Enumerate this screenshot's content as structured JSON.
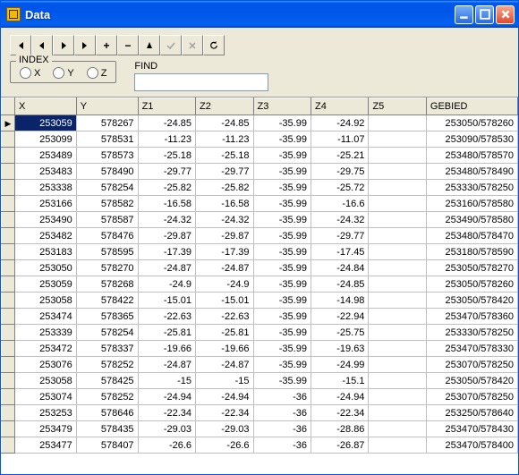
{
  "window": {
    "title": "Data"
  },
  "index_group": {
    "legend": "INDEX",
    "x_label": "X",
    "y_label": "Y",
    "z_label": "Z"
  },
  "find": {
    "label": "FIND",
    "value": ""
  },
  "columns": [
    "X",
    "Y",
    "Z1",
    "Z2",
    "Z3",
    "Z4",
    "Z5",
    "GEBIED"
  ],
  "rows": [
    {
      "X": "253059",
      "Y": "578267",
      "Z1": "-24.85",
      "Z2": "-24.85",
      "Z3": "-35.99",
      "Z4": "-24.92",
      "Z5": "",
      "GEBIED": "253050/578260"
    },
    {
      "X": "253099",
      "Y": "578531",
      "Z1": "-11.23",
      "Z2": "-11.23",
      "Z3": "-35.99",
      "Z4": "-11.07",
      "Z5": "",
      "GEBIED": "253090/578530"
    },
    {
      "X": "253489",
      "Y": "578573",
      "Z1": "-25.18",
      "Z2": "-25.18",
      "Z3": "-35.99",
      "Z4": "-25.21",
      "Z5": "",
      "GEBIED": "253480/578570"
    },
    {
      "X": "253483",
      "Y": "578490",
      "Z1": "-29.77",
      "Z2": "-29.77",
      "Z3": "-35.99",
      "Z4": "-29.75",
      "Z5": "",
      "GEBIED": "253480/578490"
    },
    {
      "X": "253338",
      "Y": "578254",
      "Z1": "-25.82",
      "Z2": "-25.82",
      "Z3": "-35.99",
      "Z4": "-25.72",
      "Z5": "",
      "GEBIED": "253330/578250"
    },
    {
      "X": "253166",
      "Y": "578582",
      "Z1": "-16.58",
      "Z2": "-16.58",
      "Z3": "-35.99",
      "Z4": "-16.6",
      "Z5": "",
      "GEBIED": "253160/578580"
    },
    {
      "X": "253490",
      "Y": "578587",
      "Z1": "-24.32",
      "Z2": "-24.32",
      "Z3": "-35.99",
      "Z4": "-24.32",
      "Z5": "",
      "GEBIED": "253490/578580"
    },
    {
      "X": "253482",
      "Y": "578476",
      "Z1": "-29.87",
      "Z2": "-29.87",
      "Z3": "-35.99",
      "Z4": "-29.77",
      "Z5": "",
      "GEBIED": "253480/578470"
    },
    {
      "X": "253183",
      "Y": "578595",
      "Z1": "-17.39",
      "Z2": "-17.39",
      "Z3": "-35.99",
      "Z4": "-17.45",
      "Z5": "",
      "GEBIED": "253180/578590"
    },
    {
      "X": "253050",
      "Y": "578270",
      "Z1": "-24.87",
      "Z2": "-24.87",
      "Z3": "-35.99",
      "Z4": "-24.84",
      "Z5": "",
      "GEBIED": "253050/578270"
    },
    {
      "X": "253059",
      "Y": "578268",
      "Z1": "-24.9",
      "Z2": "-24.9",
      "Z3": "-35.99",
      "Z4": "-24.85",
      "Z5": "",
      "GEBIED": "253050/578260"
    },
    {
      "X": "253058",
      "Y": "578422",
      "Z1": "-15.01",
      "Z2": "-15.01",
      "Z3": "-35.99",
      "Z4": "-14.98",
      "Z5": "",
      "GEBIED": "253050/578420"
    },
    {
      "X": "253474",
      "Y": "578365",
      "Z1": "-22.63",
      "Z2": "-22.63",
      "Z3": "-35.99",
      "Z4": "-22.94",
      "Z5": "",
      "GEBIED": "253470/578360"
    },
    {
      "X": "253339",
      "Y": "578254",
      "Z1": "-25.81",
      "Z2": "-25.81",
      "Z3": "-35.99",
      "Z4": "-25.75",
      "Z5": "",
      "GEBIED": "253330/578250"
    },
    {
      "X": "253472",
      "Y": "578337",
      "Z1": "-19.66",
      "Z2": "-19.66",
      "Z3": "-35.99",
      "Z4": "-19.63",
      "Z5": "",
      "GEBIED": "253470/578330"
    },
    {
      "X": "253076",
      "Y": "578252",
      "Z1": "-24.87",
      "Z2": "-24.87",
      "Z3": "-35.99",
      "Z4": "-24.99",
      "Z5": "",
      "GEBIED": "253070/578250"
    },
    {
      "X": "253058",
      "Y": "578425",
      "Z1": "-15",
      "Z2": "-15",
      "Z3": "-35.99",
      "Z4": "-15.1",
      "Z5": "",
      "GEBIED": "253050/578420"
    },
    {
      "X": "253074",
      "Y": "578252",
      "Z1": "-24.94",
      "Z2": "-24.94",
      "Z3": "-36",
      "Z4": "-24.94",
      "Z5": "",
      "GEBIED": "253070/578250"
    },
    {
      "X": "253253",
      "Y": "578646",
      "Z1": "-22.34",
      "Z2": "-22.34",
      "Z3": "-36",
      "Z4": "-22.34",
      "Z5": "",
      "GEBIED": "253250/578640"
    },
    {
      "X": "253479",
      "Y": "578435",
      "Z1": "-29.03",
      "Z2": "-29.03",
      "Z3": "-36",
      "Z4": "-28.86",
      "Z5": "",
      "GEBIED": "253470/578430"
    },
    {
      "X": "253477",
      "Y": "578407",
      "Z1": "-26.6",
      "Z2": "-26.6",
      "Z3": "-36",
      "Z4": "-26.87",
      "Z5": "",
      "GEBIED": "253470/578400"
    }
  ]
}
